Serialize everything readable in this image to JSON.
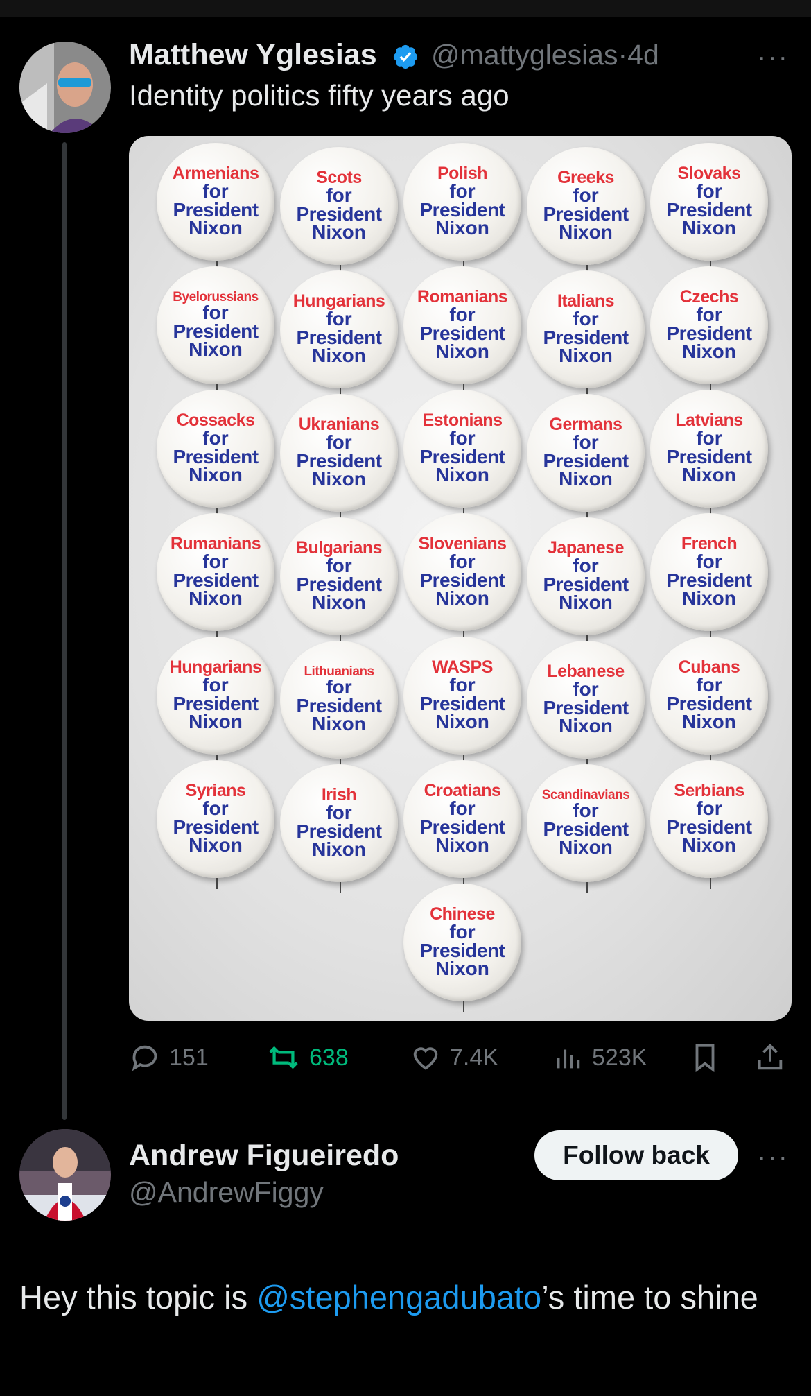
{
  "tweet": {
    "author_name": "Matthew Yglesias",
    "handle": "@mattyglesias",
    "separator": "·",
    "time": "4d",
    "text": "Identity politics fifty years ago",
    "more": "···",
    "media": {
      "buttons": [
        {
          "ethnicity": "Armenians",
          "for": "for",
          "president": "President",
          "nixon": "Nixon"
        },
        {
          "ethnicity": "Scots",
          "for": "for",
          "president": "President",
          "nixon": "Nixon"
        },
        {
          "ethnicity": "Polish",
          "for": "for",
          "president": "President",
          "nixon": "Nixon"
        },
        {
          "ethnicity": "Greeks",
          "for": "for",
          "president": "President",
          "nixon": "Nixon"
        },
        {
          "ethnicity": "Slovaks",
          "for": "for",
          "president": "President",
          "nixon": "Nixon"
        },
        {
          "ethnicity": "Byelorussians",
          "for": "for",
          "president": "President",
          "nixon": "Nixon"
        },
        {
          "ethnicity": "Hungarians",
          "for": "for",
          "president": "President",
          "nixon": "Nixon"
        },
        {
          "ethnicity": "Romanians",
          "for": "for",
          "president": "President",
          "nixon": "Nixon"
        },
        {
          "ethnicity": "Italians",
          "for": "for",
          "president": "President",
          "nixon": "Nixon"
        },
        {
          "ethnicity": "Czechs",
          "for": "for",
          "president": "President",
          "nixon": "Nixon"
        },
        {
          "ethnicity": "Cossacks",
          "for": "for",
          "president": "President",
          "nixon": "Nixon"
        },
        {
          "ethnicity": "Ukranians",
          "for": "for",
          "president": "President",
          "nixon": "Nixon"
        },
        {
          "ethnicity": "Estonians",
          "for": "for",
          "president": "President",
          "nixon": "Nixon"
        },
        {
          "ethnicity": "Germans",
          "for": "for",
          "president": "President",
          "nixon": "Nixon"
        },
        {
          "ethnicity": "Latvians",
          "for": "for",
          "president": "President",
          "nixon": "Nixon"
        },
        {
          "ethnicity": "Rumanians",
          "for": "for",
          "president": "President",
          "nixon": "Nixon"
        },
        {
          "ethnicity": "Bulgarians",
          "for": "for",
          "president": "President",
          "nixon": "Nixon"
        },
        {
          "ethnicity": "Slovenians",
          "for": "for",
          "president": "President",
          "nixon": "Nixon"
        },
        {
          "ethnicity": "Japanese",
          "for": "for",
          "president": "President",
          "nixon": "Nixon"
        },
        {
          "ethnicity": "French",
          "for": "for",
          "president": "President",
          "nixon": "Nixon"
        },
        {
          "ethnicity": "Hungarians",
          "for": "for",
          "president": "President",
          "nixon": "Nixon"
        },
        {
          "ethnicity": "Lithuanians",
          "for": "for",
          "president": "President",
          "nixon": "Nixon"
        },
        {
          "ethnicity": "WASPS",
          "for": "for",
          "president": "President",
          "nixon": "Nixon"
        },
        {
          "ethnicity": "Lebanese",
          "for": "for",
          "president": "President",
          "nixon": "Nixon"
        },
        {
          "ethnicity": "Cubans",
          "for": "for",
          "president": "President",
          "nixon": "Nixon"
        },
        {
          "ethnicity": "Syrians",
          "for": "for",
          "president": "President",
          "nixon": "Nixon"
        },
        {
          "ethnicity": "Irish",
          "for": "for",
          "president": "President",
          "nixon": "Nixon"
        },
        {
          "ethnicity": "Croatians",
          "for": "for",
          "president": "President",
          "nixon": "Nixon"
        },
        {
          "ethnicity": "Scandinavians",
          "for": "for",
          "president": "President",
          "nixon": "Nixon"
        },
        {
          "ethnicity": "Serbians",
          "for": "for",
          "president": "President",
          "nixon": "Nixon"
        },
        {
          "ethnicity": "Chinese",
          "for": "for",
          "president": "President",
          "nixon": "Nixon"
        }
      ]
    },
    "actions": {
      "replies": "151",
      "reposts": "638",
      "likes": "7.4K",
      "views": "523K"
    }
  },
  "reply": {
    "author_name": "Andrew Figueiredo",
    "handle": "@AndrewFiggy",
    "follow_label": "Follow back",
    "more": "···",
    "text_before": "Hey this topic is ",
    "mention": "@stephengadubato",
    "text_after": "’s time to shine"
  },
  "colors": {
    "background": "#000000",
    "accent": "#1d9bf0",
    "repost": "#00ba7c",
    "muted": "#71767b",
    "button_red": "#e3323a",
    "button_blue": "#27359a"
  }
}
